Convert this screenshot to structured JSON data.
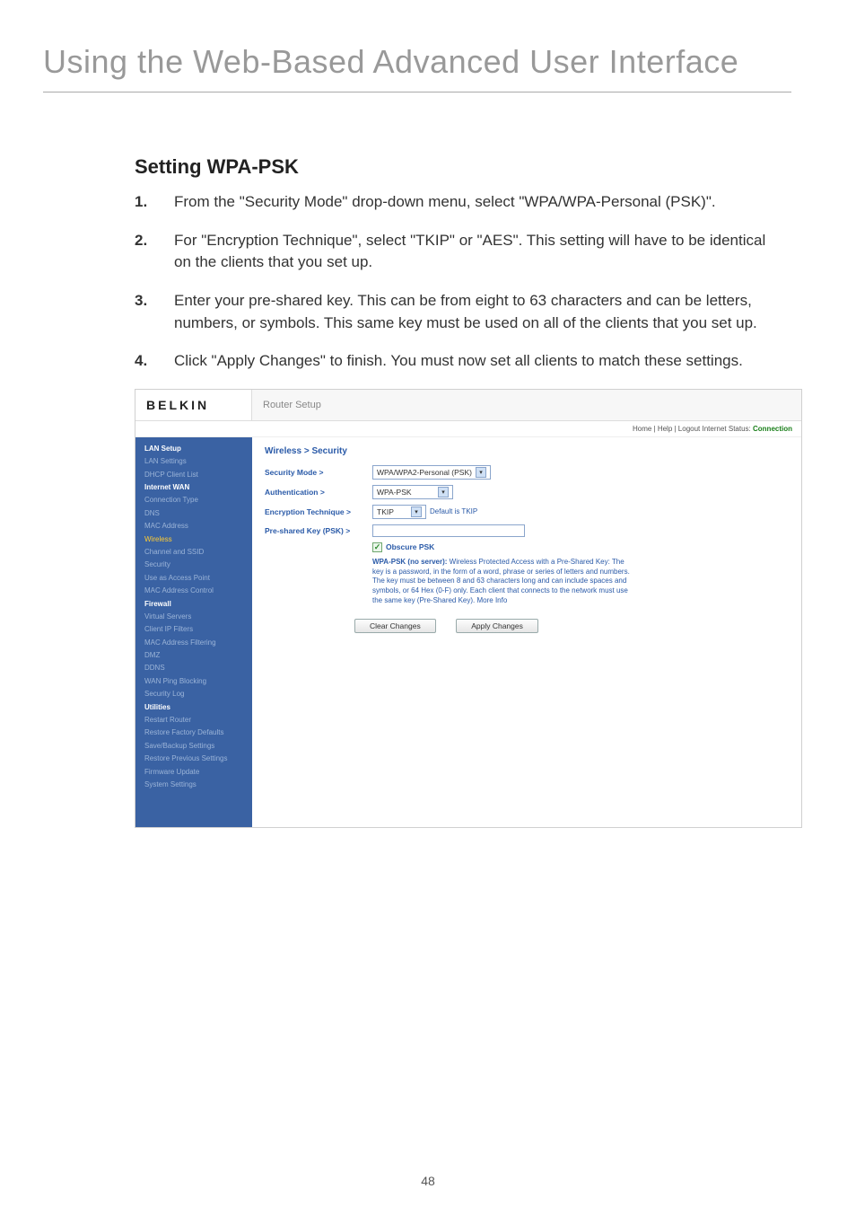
{
  "page": {
    "title": "Using the Web-Based Advanced User Interface",
    "section": "Setting WPA-PSK",
    "page_number": "48"
  },
  "steps": [
    {
      "num": "1.",
      "text": "From the \"Security Mode\" drop-down menu, select \"WPA/WPA-Personal (PSK)\"."
    },
    {
      "num": "2.",
      "text": "For \"Encryption Technique\", select \"TKIP\" or \"AES\". This setting will have to be identical on the clients that you set up."
    },
    {
      "num": "3.",
      "text": "Enter your pre-shared key. This can be from eight to 63 characters and can be letters, numbers, or symbols. This same key must be used on all of the clients that you set up."
    },
    {
      "num": "4.",
      "text": "Click \"Apply Changes\" to finish. You must now set all clients to match these settings."
    }
  ],
  "router": {
    "brand": "BELKIN",
    "header": "Router Setup",
    "topnav": "Home | Help | Logout   Internet Status:",
    "status": "Connection",
    "breadcrumb": "Wireless > Security",
    "sidebar": [
      {
        "label": "LAN Setup",
        "cls": "sb-head"
      },
      {
        "label": "LAN Settings",
        "cls": "sb-dim"
      },
      {
        "label": "DHCP Client List",
        "cls": "sb-dim"
      },
      {
        "label": "Internet WAN",
        "cls": "sb-head"
      },
      {
        "label": "Connection Type",
        "cls": "sb-dim"
      },
      {
        "label": "DNS",
        "cls": "sb-dim"
      },
      {
        "label": "MAC Address",
        "cls": "sb-dim"
      },
      {
        "label": "Wireless",
        "cls": "sb-active"
      },
      {
        "label": "Channel and SSID",
        "cls": "sb-dim"
      },
      {
        "label": "Security",
        "cls": "sb-dim"
      },
      {
        "label": "Use as Access Point",
        "cls": "sb-dim"
      },
      {
        "label": "MAC Address Control",
        "cls": "sb-dim"
      },
      {
        "label": "Firewall",
        "cls": "sb-head"
      },
      {
        "label": "Virtual Servers",
        "cls": "sb-dim"
      },
      {
        "label": "Client IP Filters",
        "cls": "sb-dim"
      },
      {
        "label": "MAC Address Filtering",
        "cls": "sb-dim"
      },
      {
        "label": "DMZ",
        "cls": "sb-dim"
      },
      {
        "label": "DDNS",
        "cls": "sb-dim"
      },
      {
        "label": "WAN Ping Blocking",
        "cls": "sb-dim"
      },
      {
        "label": "Security Log",
        "cls": "sb-dim"
      },
      {
        "label": "Utilities",
        "cls": "sb-head"
      },
      {
        "label": "Restart Router",
        "cls": "sb-dim"
      },
      {
        "label": "Restore Factory Defaults",
        "cls": "sb-dim"
      },
      {
        "label": "Save/Backup Settings",
        "cls": "sb-dim"
      },
      {
        "label": "Restore Previous Settings",
        "cls": "sb-dim"
      },
      {
        "label": "Firmware Update",
        "cls": "sb-dim"
      },
      {
        "label": "System Settings",
        "cls": "sb-dim"
      }
    ],
    "form": {
      "security_mode_label": "Security Mode >",
      "security_mode_value": "WPA/WPA2-Personal (PSK)",
      "auth_label": "Authentication >",
      "auth_value": "WPA-PSK",
      "enc_label": "Encryption Technique >",
      "enc_value": "TKIP",
      "enc_default": "Default is TKIP",
      "psk_label": "Pre-shared Key (PSK) >",
      "obscure_label": "Obscure PSK",
      "desc_bold": "WPA-PSK (no server):",
      "desc_rest": " Wireless Protected Access with a Pre-Shared Key: The key is a password, in the form of a word, phrase or series of letters and numbers. The key must be between 8 and 63 characters long and can include spaces and symbols, or 64 Hex (0-F) only. Each client that connects to the network must use the same key (Pre-Shared Key). More Info",
      "btn_clear": "Clear Changes",
      "btn_apply": "Apply Changes"
    }
  }
}
